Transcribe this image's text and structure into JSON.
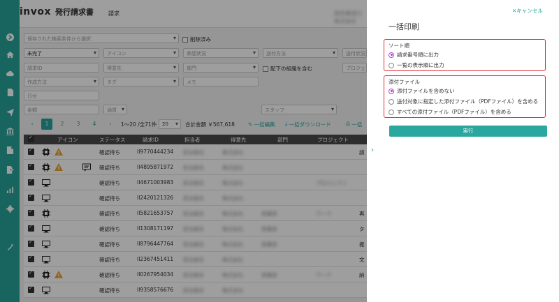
{
  "header": {
    "brand": "invox",
    "product": "発行請求書",
    "nav_item": "請求",
    "user_info": "請求書発行 株式会社"
  },
  "sidebar": {
    "icons": [
      "arrow-right-circle-icon",
      "home-icon",
      "cloud-upload-icon",
      "document-icon",
      "send-icon",
      "bank-icon",
      "building-icon",
      "file-export-icon",
      "chart-icon",
      "gear-icon",
      "tool-icon"
    ]
  },
  "filters": {
    "saved_search_placeholder": "保存された検索条件から選択",
    "deleted_label": "削除済み",
    "status_value": "未完了",
    "icon_placeholder": "アイコン",
    "approval_placeholder": "承認状況",
    "send_method_placeholder": "送付方法",
    "send_status_placeholder": "送付状況",
    "invoice_id_placeholder": "請求ID",
    "customer_placeholder": "得意先",
    "department_placeholder": "部門",
    "include_sub_org_label": "配下の組織を含む",
    "project_placeholder": "プロジェクト",
    "create_method_placeholder": "作成方法",
    "tag_placeholder": "タグ",
    "memo_placeholder": "メモ",
    "date_placeholder": "日付",
    "amount_placeholder": "金額",
    "currency_placeholder": "通貨",
    "staff_placeholder": "スタッフ"
  },
  "pagination": {
    "pages": [
      "1",
      "2",
      "3",
      "4"
    ],
    "prev": "‹",
    "next": "›",
    "range_text": "1〜20 /全71件",
    "page_size": "20",
    "total_text": "合計金額 ￥567,618",
    "bulk_edit": "一括編集",
    "bulk_download": "一括ダウンロード",
    "bulk_print": "一括"
  },
  "table": {
    "headers": [
      "アイコン",
      "ステータス",
      "請求ID",
      "担当者",
      "得意先",
      "部門",
      "プロジェクト"
    ],
    "rows": [
      {
        "status": "確認待ち",
        "id": "II9770444234",
        "staff": "担当者名",
        "customer": "株式会社",
        "dept": "",
        "project": "",
        "extra": "請"
      },
      {
        "status": "確認待ち",
        "id": "II4895871972",
        "staff": "担当者名",
        "customer": "株式会社",
        "dept": "",
        "project": "",
        "extra": ""
      },
      {
        "status": "確認待ち",
        "id": "II4671003983",
        "staff": "担当者名",
        "customer": "株式会社",
        "dept": "",
        "project": "プロジェクト",
        "extra": ""
      },
      {
        "status": "確認待ち",
        "id": "II2420121326",
        "staff": "担当者名",
        "customer": "株式会社",
        "dept": "",
        "project": "",
        "extra": ""
      },
      {
        "status": "確認待ち",
        "id": "II5821653757",
        "staff": "担当者名",
        "customer": "株式会社",
        "dept": "営業部",
        "project": "ワーク",
        "extra": "再"
      },
      {
        "status": "確認待ち",
        "id": "II1308171197",
        "staff": "担当者名",
        "customer": "株式会社",
        "dept": "営業部",
        "project": "",
        "extra": "タ"
      },
      {
        "status": "確認待ち",
        "id": "II8796447764",
        "staff": "担当者名",
        "customer": "株式会社",
        "dept": "営業部",
        "project": "",
        "extra": "振"
      },
      {
        "status": "確認待ち",
        "id": "II2367451411",
        "staff": "担当者名",
        "customer": "株式会社",
        "dept": "",
        "project": "",
        "extra": "文"
      },
      {
        "status": "確認待ち",
        "id": "II0267954034",
        "staff": "担当者名",
        "customer": "株式会社",
        "dept": "営業部",
        "project": "ワーク",
        "extra": "納"
      },
      {
        "status": "確認待ち",
        "id": "II9358576676",
        "staff": "担当者名",
        "customer": "株式会社",
        "dept": "",
        "project": "",
        "extra": ""
      }
    ]
  },
  "panel": {
    "cancel_label": "キャンセル",
    "title": "一括印刷",
    "sort_group_title": "ソート順",
    "sort_options": [
      "請求番号順に出力",
      "一覧の表示順に出力"
    ],
    "attach_group_title": "添付ファイル",
    "attach_options": [
      "添付ファイルを含めない",
      "送付対象に指定した添付ファイル（PDFファイル）を含める",
      "すべての添付ファイル（PDFファイル）を含める"
    ],
    "run_label": "実行"
  },
  "colors": {
    "accent": "#27a39b",
    "highlight": "#e0303a",
    "radio": "#b23bd1"
  }
}
